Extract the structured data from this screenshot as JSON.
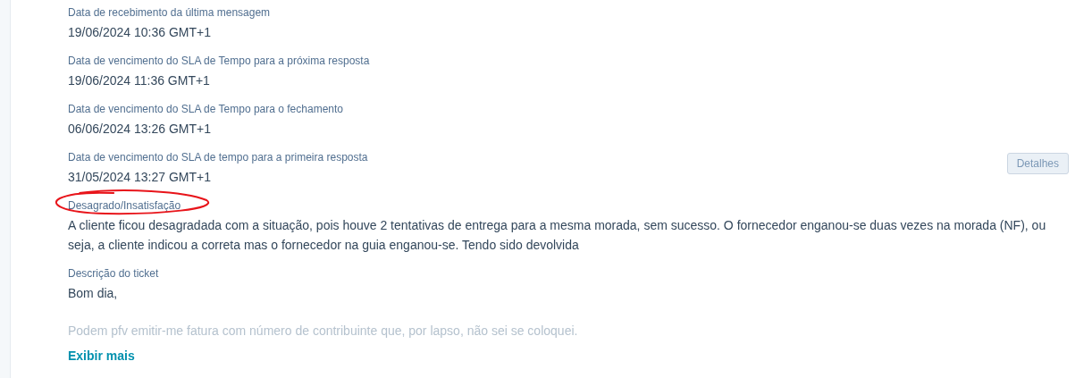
{
  "fields": [
    {
      "label": "Data de recebimento da última mensagem",
      "value": "19/06/2024 10:36 GMT+1",
      "circled": false
    },
    {
      "label": "Data de vencimento do SLA de Tempo para a próxima resposta",
      "value": "19/06/2024 11:36 GMT+1",
      "circled": false
    },
    {
      "label": "Data de vencimento do SLA de Tempo para o fechamento",
      "value": "06/06/2024 13:26 GMT+1",
      "circled": false
    },
    {
      "label": "Data de vencimento do SLA de tempo para a primeira resposta",
      "value": "31/05/2024 13:27 GMT+1",
      "circled": false,
      "button": "Detalhes"
    },
    {
      "label": "Desagrado/Insatisfação",
      "value": "A cliente ficou desagradada com a situação, pois houve 2 tentativas de entrega para a mesma morada, sem sucesso. O fornecedor enganou-se duas vezes na morada (NF), ou seja, a cliente indicou a correta mas o fornecedor na guia enganou-se. Tendo sido devolvida",
      "circled": true
    }
  ],
  "description": {
    "label": "Descrição do ticket",
    "paragraphs": [
      {
        "text": "Bom dia,",
        "faded": false
      },
      {
        "text": "Podem pfv emitir-me fatura com número de contribuinte que, por lapso, não sei se coloquei.",
        "faded": true
      }
    ],
    "show_more": "Exibir mais"
  }
}
